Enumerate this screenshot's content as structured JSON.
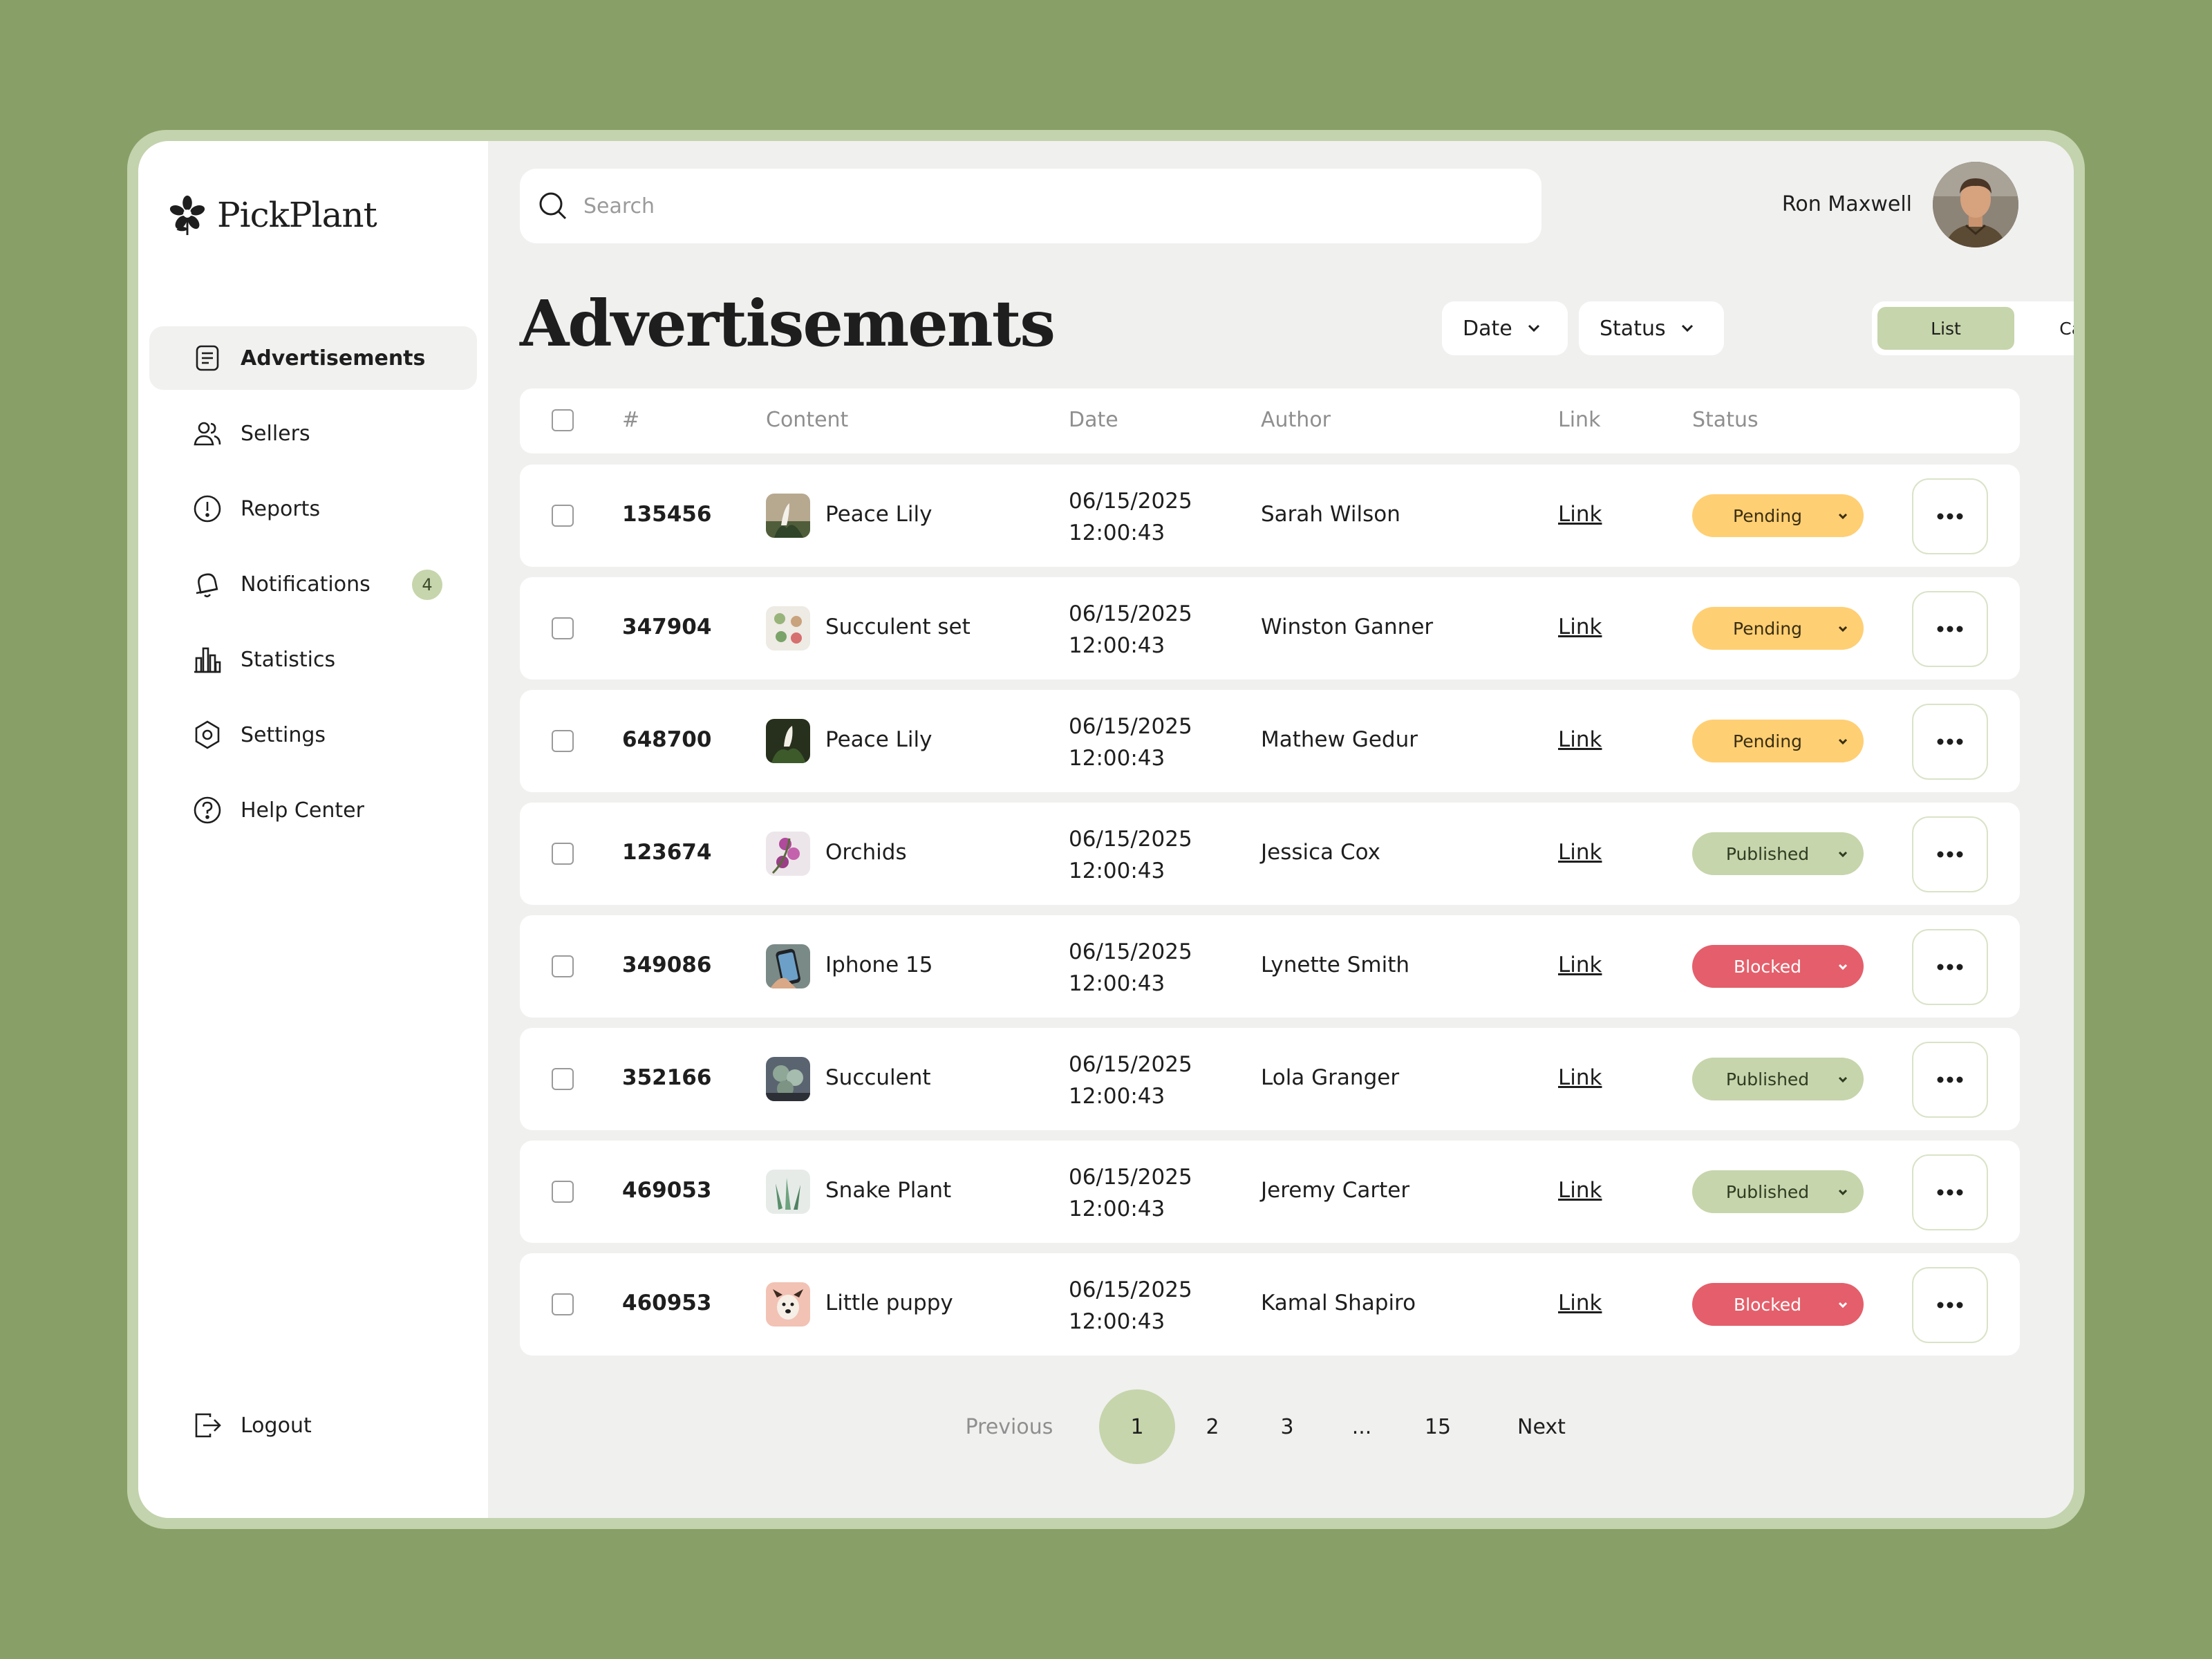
{
  "brand": {
    "name": "PickPlant"
  },
  "sidebar": {
    "items": [
      {
        "label": "Advertisements",
        "icon": "document-icon"
      },
      {
        "label": "Sellers",
        "icon": "users-icon"
      },
      {
        "label": "Reports",
        "icon": "alert-circle-icon"
      },
      {
        "label": "Notifications",
        "icon": "bell-icon",
        "badge": "4"
      },
      {
        "label": "Statistics",
        "icon": "bar-chart-icon"
      },
      {
        "label": "Settings",
        "icon": "settings-hex-icon"
      },
      {
        "label": "Help Center",
        "icon": "help-circle-icon"
      }
    ],
    "logout": "Logout"
  },
  "search": {
    "placeholder": "Search"
  },
  "user": {
    "name": "Ron Maxwell"
  },
  "page": {
    "title": "Advertisements"
  },
  "filters": {
    "date": "Date",
    "status": "Status"
  },
  "view_toggle": {
    "list": "List",
    "cards": "Cards",
    "selected": "List"
  },
  "table": {
    "headers": [
      "#",
      "Content",
      "Date",
      "Author",
      "Link",
      "Status"
    ],
    "rows": [
      {
        "id": "135456",
        "content": "Peace Lily",
        "date": "06/15/2025",
        "time": "12:00:43",
        "author": "Sarah Wilson",
        "link": "Link",
        "status": "Pending"
      },
      {
        "id": "347904",
        "content": "Succulent set",
        "date": "06/15/2025",
        "time": "12:00:43",
        "author": "Winston Ganner",
        "link": "Link",
        "status": "Pending"
      },
      {
        "id": "648700",
        "content": "Peace Lily",
        "date": "06/15/2025",
        "time": "12:00:43",
        "author": "Mathew Gedur",
        "link": "Link",
        "status": "Pending"
      },
      {
        "id": "123674",
        "content": "Orchids",
        "date": "06/15/2025",
        "time": "12:00:43",
        "author": "Jessica Cox",
        "link": "Link",
        "status": "Published"
      },
      {
        "id": "349086",
        "content": "Iphone 15",
        "date": "06/15/2025",
        "time": "12:00:43",
        "author": "Lynette Smith",
        "link": "Link",
        "status": "Blocked"
      },
      {
        "id": "352166",
        "content": "Succulent",
        "date": "06/15/2025",
        "time": "12:00:43",
        "author": "Lola Granger",
        "link": "Link",
        "status": "Published"
      },
      {
        "id": "469053",
        "content": "Snake Plant",
        "date": "06/15/2025",
        "time": "12:00:43",
        "author": "Jeremy Carter",
        "link": "Link",
        "status": "Published"
      },
      {
        "id": "460953",
        "content": "Little puppy",
        "date": "06/15/2025",
        "time": "12:00:43",
        "author": "Kamal Shapiro",
        "link": "Link",
        "status": "Blocked"
      }
    ]
  },
  "pagination": {
    "previous": "Previous",
    "pages": [
      "1",
      "2",
      "3",
      "...",
      "15"
    ],
    "current": "1",
    "next": "Next"
  },
  "colors": {
    "background": "#88a067",
    "accent": "#c6d5ab",
    "pending": "#ffcf74",
    "published": "#c6d5ab",
    "blocked": "#e45f6b"
  }
}
